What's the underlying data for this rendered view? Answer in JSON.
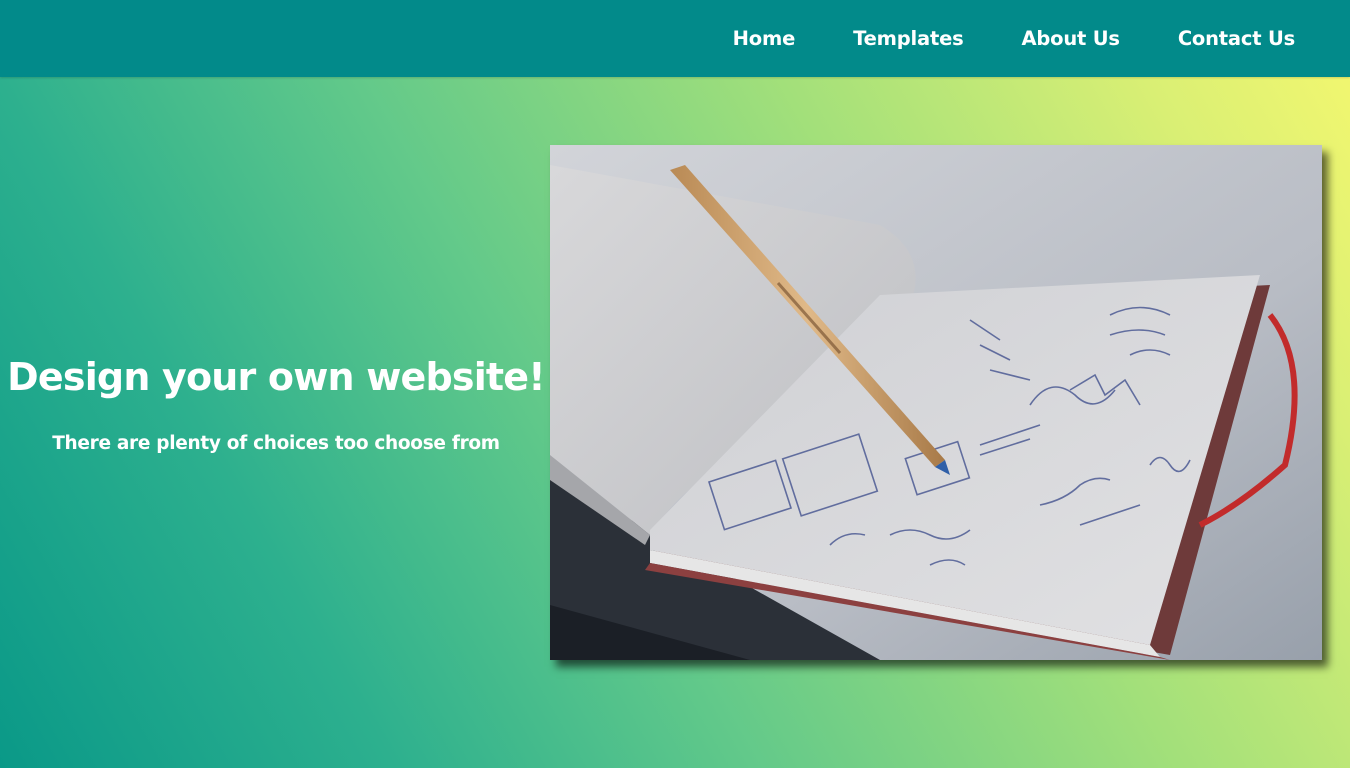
{
  "nav": {
    "items": [
      {
        "label": "Home"
      },
      {
        "label": "Templates"
      },
      {
        "label": "About Us"
      },
      {
        "label": "Contact Us"
      }
    ]
  },
  "hero": {
    "title": "Design your own website!",
    "subtitle": "There are plenty of choices too choose from"
  },
  "colors": {
    "navbar": "#028a8a",
    "gradient_start": "#0a9988",
    "gradient_end": "#f6f86f",
    "text": "#ffffff"
  },
  "image": {
    "subject": "open sketchbook with pencil drawings and a wooden pen"
  }
}
